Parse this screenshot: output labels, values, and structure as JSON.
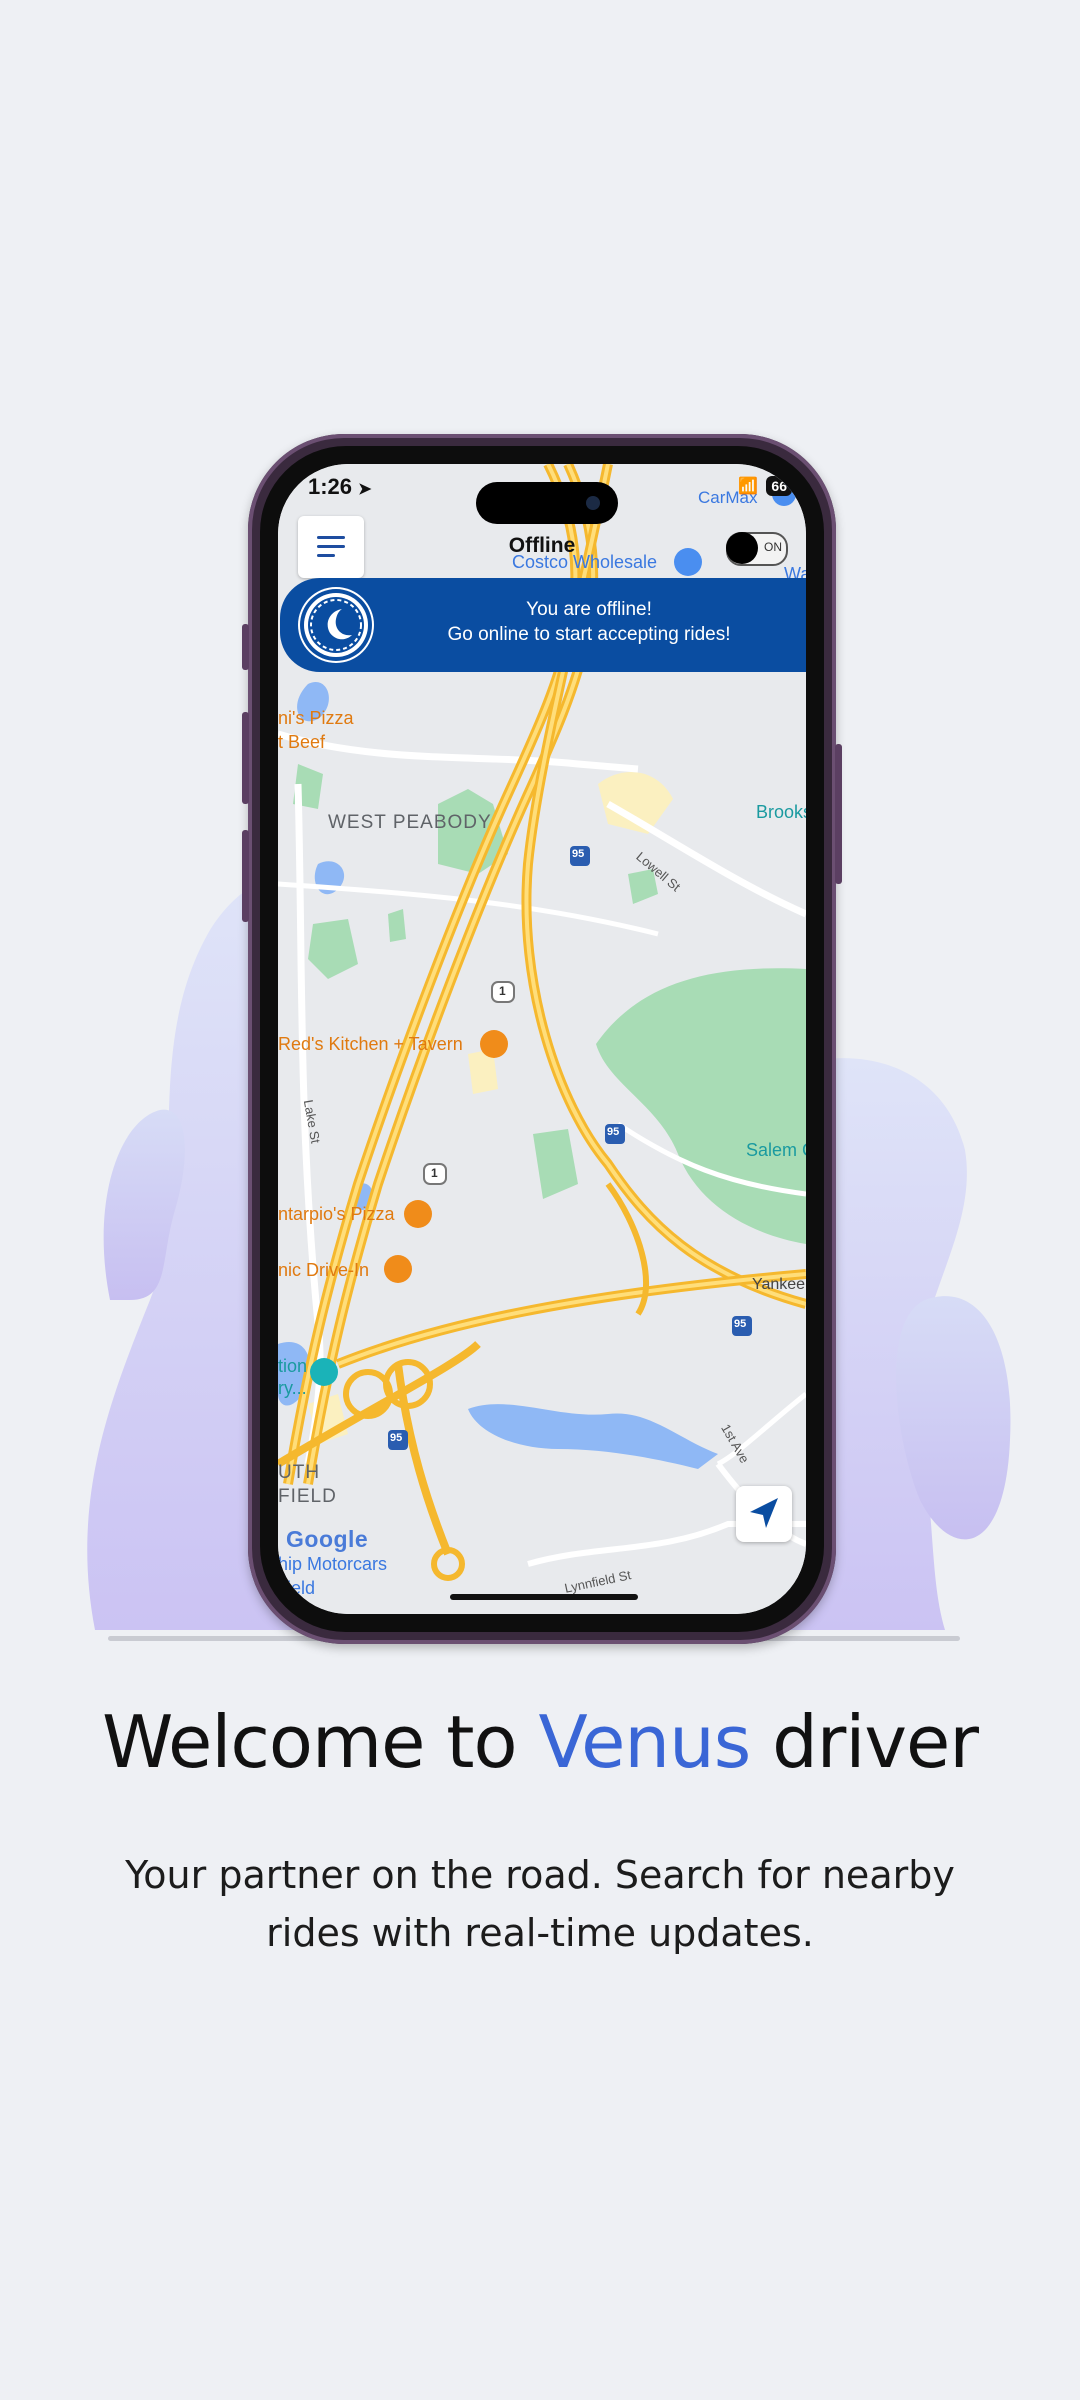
{
  "colors": {
    "background": "#eef0f4",
    "accent": "#3a66d6",
    "banner": "#0a4da1",
    "phone_frame": "#3a2a3e"
  },
  "status_bar": {
    "time": "1:26",
    "battery": "66"
  },
  "app": {
    "title": "Offline",
    "toggle_label": "ON",
    "banner_line1": "You are offline!",
    "banner_line2": "Go online to start accepting rides!"
  },
  "map": {
    "labels": {
      "carmax": "CarMax",
      "costco": "Costco Wholesale",
      "wa": "Wa",
      "pizza": "ni's Pizza",
      "beef": "t Beef",
      "west_peabody": "WEST PEABODY",
      "brooks": "Brooks",
      "lowell": "Lowell St",
      "reds": "Red's Kitchen + Tavern",
      "lake": "Lake St",
      "salem": "Salem C",
      "tarpio": "ntarpio's Pizza",
      "drive_in": "nic Drive-In",
      "yankee": "Yankee",
      "tion": "tion",
      "ry": "ry...",
      "uth": "UTH",
      "field": "FIELD",
      "first_ave": "1st Ave",
      "motorcars": "hip Motorcars",
      "ifield": "ifield",
      "lynnfield": "Lynnfield St",
      "route_95a": "95",
      "route_95b": "95",
      "route_95c": "95",
      "route_95d": "95",
      "route_1a": "1",
      "route_1b": "1",
      "google": "Google"
    }
  },
  "welcome": {
    "prefix": "Welcome to ",
    "brand": "Venus",
    "suffix": " driver",
    "subtitle": "Your partner on the road. Search for nearby rides with real-time updates."
  }
}
